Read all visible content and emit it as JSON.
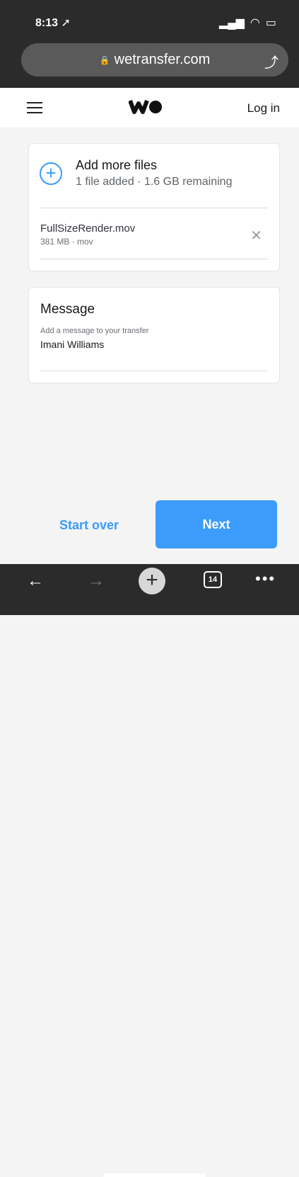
{
  "status_bar": {
    "time": "8:13",
    "location_icon": "location-arrow-icon"
  },
  "browser": {
    "url": "wetransfer.com",
    "tab_count": "14"
  },
  "header": {
    "login_label": "Log in"
  },
  "files_card": {
    "add_title": "Add more files",
    "add_subtitle": "1 file added · 1.6 GB remaining",
    "file": {
      "name": "FullSizeRender.mov",
      "meta": "381 MB · mov"
    }
  },
  "message_card": {
    "title": "Message",
    "label": "Add a message to your transfer",
    "value": "Imani Williams"
  },
  "actions": {
    "start_over": "Start over",
    "next": "Next"
  },
  "colors": {
    "accent": "#3c9cfb",
    "toolbar_bg": "#2b2b2b"
  }
}
